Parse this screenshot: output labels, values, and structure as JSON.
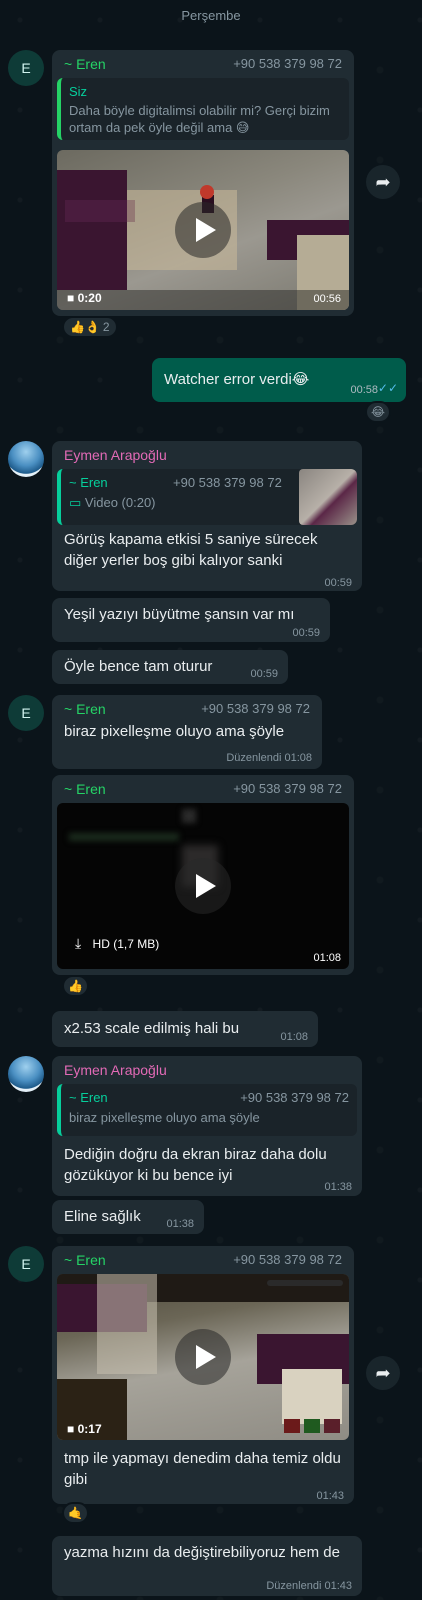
{
  "day_label": "Perşembe",
  "m1": {
    "avatar": "E",
    "sender": "~ Eren",
    "phone": "+90 538 379 98 72",
    "quote_name": "Siz",
    "quote_text": "Daha böyle digitalimsi olabilir mi? Gerçi bizim ortam da pek öyle değil ama 😅",
    "video_length": "0:20",
    "time": "00:56",
    "reactions": "👍👌",
    "reaction_count": "2"
  },
  "m2": {
    "text": "Watcher error verdi😂",
    "time": "00:58",
    "reaction": "😂"
  },
  "m3": {
    "sender": "Eymen Arapoğlu",
    "quote_name": "~ Eren",
    "quote_phone": "+90 538 379 98 72",
    "quote_type": "Video (0:20)",
    "text": "Görüş kapama etkisi 5 saniye sürecek diğer yerler boş gibi kalıyor sanki",
    "time": "00:59"
  },
  "m4": {
    "text": "Yeşil yazıyı büyütme şansın var mı",
    "time": "00:59"
  },
  "m5": {
    "text": "Öyle bence tam oturur",
    "time": "00:59"
  },
  "m6": {
    "avatar": "E",
    "sender": "~ Eren",
    "phone": "+90 538 379 98 72",
    "text": "biraz pixelleşme oluyo ama şöyle",
    "edited": "Düzenlendi",
    "time": "01:08"
  },
  "m7": {
    "sender": "~ Eren",
    "phone": "+90 538 379 98 72",
    "download_label": "HD (1,7 MB)",
    "time": "01:08",
    "reaction": "👍"
  },
  "m8": {
    "text": "x2.53 scale edilmiş hali bu",
    "time": "01:08"
  },
  "m9": {
    "sender": "Eymen Arapoğlu",
    "quote_name": "~ Eren",
    "quote_phone": "+90 538 379 98 72",
    "quote_text": "biraz pixelleşme oluyo ama şöyle",
    "text": "Dediğin doğru da ekran biraz daha dolu gözüküyor ki bu bence iyi",
    "time": "01:38"
  },
  "m10": {
    "text": "Eline sağlık",
    "time": "01:38"
  },
  "m11": {
    "avatar": "E",
    "sender": "~ Eren",
    "phone": "+90 538 379 98 72",
    "video_length": "0:17",
    "text": "tmp ile yapmayı denedim daha temiz oldu gibi",
    "time": "01:43",
    "reaction": "🤙"
  },
  "m12": {
    "text": "yazma hızını da değiştirebiliyoruz hem de",
    "edited": "Düzenlendi",
    "time": "01:43"
  }
}
